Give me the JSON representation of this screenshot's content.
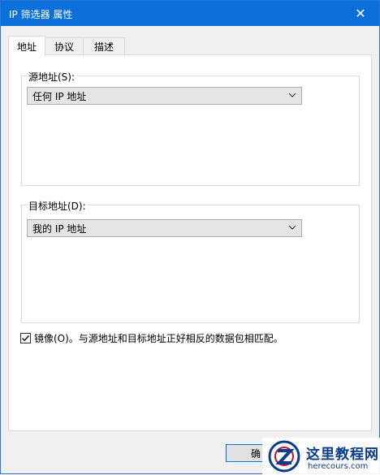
{
  "window": {
    "title": "IP 筛选器 属性",
    "close_glyph": "✕"
  },
  "tabs": [
    {
      "label": "地址",
      "active": true
    },
    {
      "label": "协议",
      "active": false
    },
    {
      "label": "描述",
      "active": false
    }
  ],
  "source_group": {
    "label": "源地址(S):",
    "selected_value": "任何 IP 地址"
  },
  "destination_group": {
    "label": "目标地址(D):",
    "selected_value": "我的 IP 地址"
  },
  "mirror": {
    "checked": true,
    "label": "镜像(O)。与源地址和目标地址正好相反的数据包相匹配。"
  },
  "buttons": {
    "ok_label": "确"
  },
  "watermark": {
    "title": "这里教程网",
    "url": "herecours.com"
  },
  "colors": {
    "titlebar": "#0a6fd9",
    "accent": "#0078d7"
  }
}
